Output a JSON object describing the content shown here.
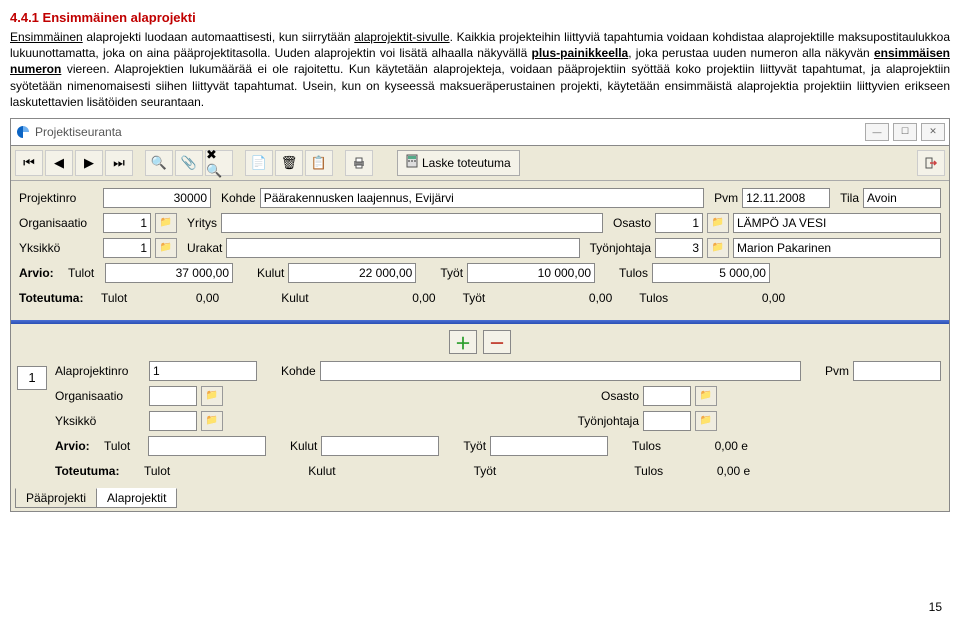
{
  "section": {
    "number": "4.4.1",
    "title": "Ensimmäinen alaprojekti"
  },
  "paragraph": {
    "p1a": "Ensimmäinen",
    "p1b": " alaprojekti luodaan automaattisesti, kun siirrytään ",
    "p1c": "alaprojektit-sivulle",
    "p1d": ". Kaikkia projekteihin liittyviä tapahtumia voidaan kohdistaa alaprojektille maksupostitaulukkoa lukuunottamatta, joka on aina pääprojektitasolla. Uuden alaprojektin voi lisätä alhaalla näkyvällä ",
    "p1e": "plus-painikkeella",
    "p1f": ", joka perustaa uuden numeron alla näkyvän ",
    "p1g": "ensimmäisen numeron",
    "p1h": " viereen. Alaprojektien lukumäärää ei ole rajoitettu. Kun käytetään alaprojekteja, voidaan pääprojektiin syöttää koko projektiin liittyvät tapahtumat, ja alaprojektiin syötetään nimenomaisesti siihen liittyvät tapahtumat. Usein, kun on kyseessä maksueräperustainen projekti, käytetään ensimmäistä alaprojektia projektiin liittyvien erikseen laskutettavien lisätöiden seurantaan."
  },
  "window": {
    "title": "Projektiseuranta",
    "calc_button": "Laske toteutuma"
  },
  "main": {
    "labels": {
      "projektinro": "Projektinro",
      "kohde": "Kohde",
      "pvm": "Pvm",
      "tila": "Tila",
      "organisaatio": "Organisaatio",
      "yritys": "Yritys",
      "osasto": "Osasto",
      "yksikko": "Yksikkö",
      "urakat": "Urakat",
      "tyonjohtaja": "Työnjohtaja",
      "arvio": "Arvio:",
      "tulot": "Tulot",
      "kulut": "Kulut",
      "tyot": "Työt",
      "tulos": "Tulos",
      "toteutuma": "Toteutuma:"
    },
    "values": {
      "projektinro": "30000",
      "kohde": "Päärakennusken laajennus, Evijärvi",
      "pvm": "12.11.2008",
      "tila": "Avoin",
      "organisaatio": "1",
      "osasto": "1",
      "osasto_name": "LÄMPÖ JA VESI",
      "yksikko": "1",
      "tyonjohtaja": "3",
      "tyonjohtaja_name": "Marion Pakarinen",
      "arvio_tulot": "37 000,00",
      "arvio_kulut": "22 000,00",
      "arvio_tyot": "10 000,00",
      "arvio_tulos": "5 000,00",
      "tot_tulot": "0,00",
      "tot_kulut": "0,00",
      "tot_tyot": "0,00",
      "tot_tulos": "0,00"
    }
  },
  "sub": {
    "num": "1",
    "labels": {
      "alaprojektinro": "Alaprojektinro",
      "kohde": "Kohde",
      "pvm": "Pvm",
      "organisaatio": "Organisaatio",
      "osasto": "Osasto",
      "yksikko": "Yksikkö",
      "tyonjohtaja": "Työnjohtaja"
    },
    "values": {
      "alaprojektinro": "1",
      "tulos": "0,00 e",
      "tot_tulos": "0,00 e"
    }
  },
  "tabs": {
    "paaprojekti": "Pääprojekti",
    "alaprojektit": "Alaprojektit"
  },
  "page": "15"
}
